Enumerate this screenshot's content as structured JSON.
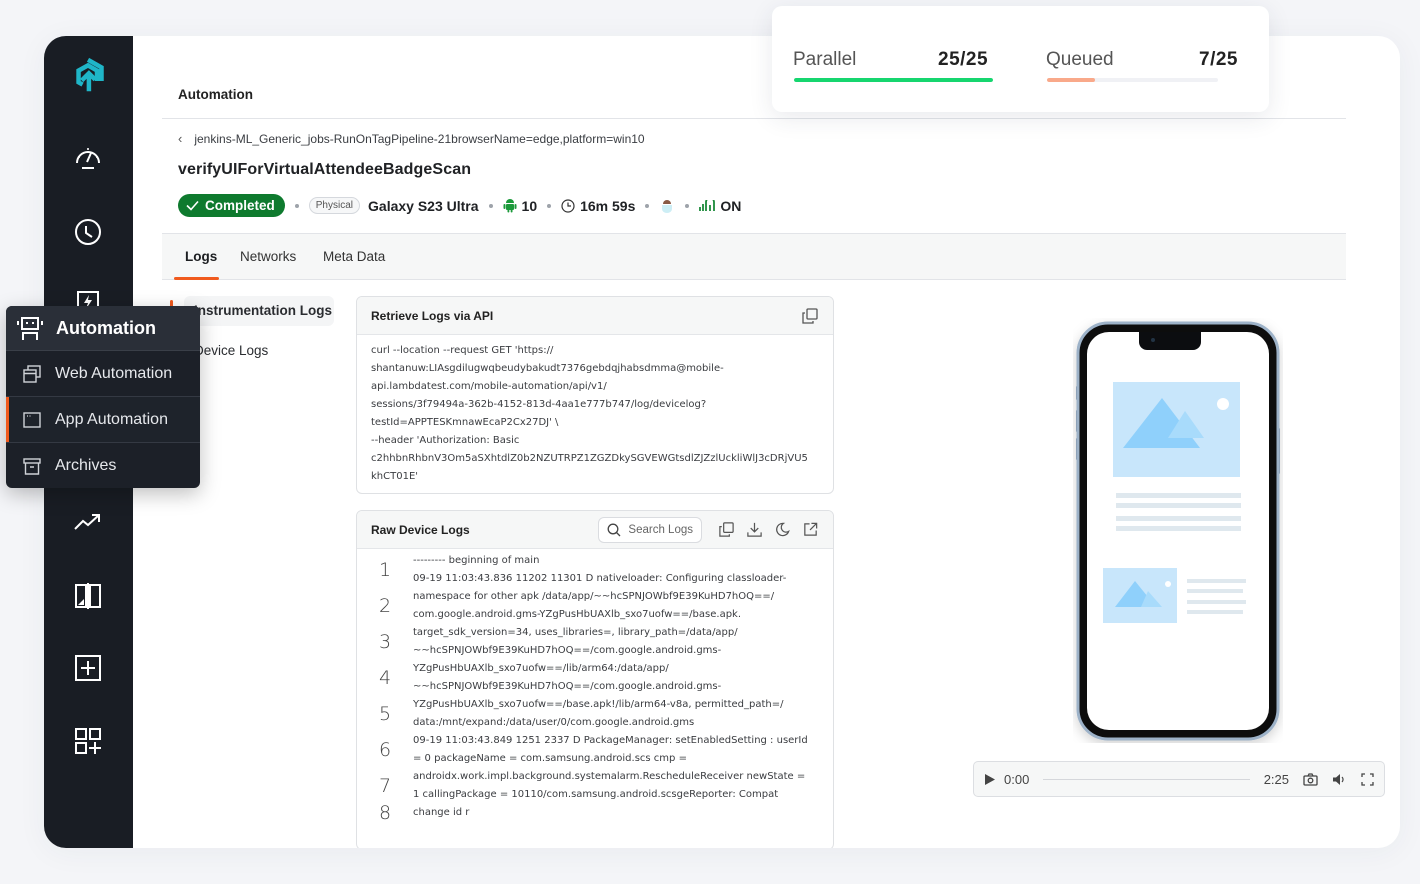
{
  "header": {
    "title": "Automation"
  },
  "stats": {
    "parallel": {
      "label": "Parallel",
      "value": "25/25",
      "fraction": 1.0,
      "color": "#16d66f"
    },
    "queued": {
      "label": "Queued",
      "value": "7/25",
      "fraction": 0.28,
      "color": "#f9a98a"
    }
  },
  "breadcrumb": {
    "back_icon": "chevron-left-icon",
    "build_name": "jenkins-ML_Generic_jobs-RunOnTagPipeline-21browserName=edge,platform=win10"
  },
  "test": {
    "name": "verifyUIForVirtualAttendeeBadgeScan",
    "status": "Completed",
    "device_type": "Physical",
    "device_name": "Galaxy S23 Ultra",
    "os_version": "10",
    "duration": "16m 59s",
    "network": "ON"
  },
  "tabs": [
    {
      "label": "Logs",
      "active": true
    },
    {
      "label": "Networks",
      "active": false
    },
    {
      "label": "Meta Data",
      "active": false
    }
  ],
  "log_nav": [
    {
      "label": "Instrumentation Logs",
      "active": true
    },
    {
      "label": "Device Logs",
      "active": false
    }
  ],
  "api_card": {
    "title": "Retrieve Logs via API",
    "lines": [
      "curl --location --request GET 'https://",
      "shantanuw:LIAsgdilugwqbeudybakudt7376gebdqjhabsdmma@mobile-",
      "api.lambdatest.com/mobile-automation/api/v1/",
      "sessions/3f79494a-362b-4152-813d-4aa1e777b747/log/devicelog?",
      "testId=APPTESKmnawEcaP2Cx27DJ' \\",
      "--header 'Authorization: Basic",
      "c2hhbnRhbnV3Om5aSXhtdlZ0b2NZUTRPZ1ZGZDkySGVEWGtsdlZJZzlUckliWlJ3cDRjVU5",
      "khCT01E'"
    ]
  },
  "raw_logs": {
    "title": "Raw Device Logs",
    "search_placeholder": "Search Logs",
    "entries": [
      {
        "num": "1",
        "lines": [
          "--------- beginning of main",
          "09-19 11:03:43.836 11202 11301 D nativeloader: Configuring classloader-"
        ]
      },
      {
        "num": "2",
        "lines": [
          "namespace for other apk /data/app/~~hcSPNJOWbf9E39KuHD7hOQ==/",
          "com.google.android.gms-YZgPusHbUAXlb_sxo7uofw==/base.apk."
        ]
      },
      {
        "num": "3",
        "lines": [
          "target_sdk_version=34, uses_libraries=, library_path=/data/app/",
          "~~hcSPNJOWbf9E39KuHD7hOQ==/com.google.android.gms-"
        ]
      },
      {
        "num": "4",
        "lines": [
          "YZgPusHbUAXlb_sxo7uofw==/lib/arm64:/data/app/",
          "~~hcSPNJOWbf9E39KuHD7hOQ==/com.google.android.gms-"
        ]
      },
      {
        "num": "5",
        "lines": [
          "YZgPusHbUAXlb_sxo7uofw==/base.apk!/lib/arm64-v8a, permitted_path=/",
          "data:/mnt/expand:/data/user/0/com.google.android.gms"
        ]
      },
      {
        "num": "6",
        "lines": [
          "09-19 11:03:43.849  1251  2337 D PackageManager: setEnabledSetting : userId",
          "= 0 packageName = com.samsung.android.scs cmp ="
        ]
      },
      {
        "num": "7",
        "lines": [
          "androidx.work.impl.background.systemalarm.RescheduleReceiver newState =",
          "1 callingPackage = 10110/com.samsung.android.scsgeReporter: Compat"
        ]
      },
      {
        "num": "8",
        "lines": [
          "change id r"
        ]
      }
    ]
  },
  "player": {
    "current_time": "0:00",
    "total_time": "2:25"
  },
  "automation_menu": {
    "title": "Automation",
    "items": [
      {
        "label": "Web Automation",
        "icon": "windows-icon",
        "active": false
      },
      {
        "label": "App Automation",
        "icon": "app-window-icon",
        "active": true
      },
      {
        "label": "Archives",
        "icon": "archive-icon",
        "active": false
      }
    ]
  },
  "colors": {
    "accent": "#f05a1e",
    "success": "#0e7a2e",
    "brand": "#1fb6c8",
    "rail": "#191d24"
  }
}
